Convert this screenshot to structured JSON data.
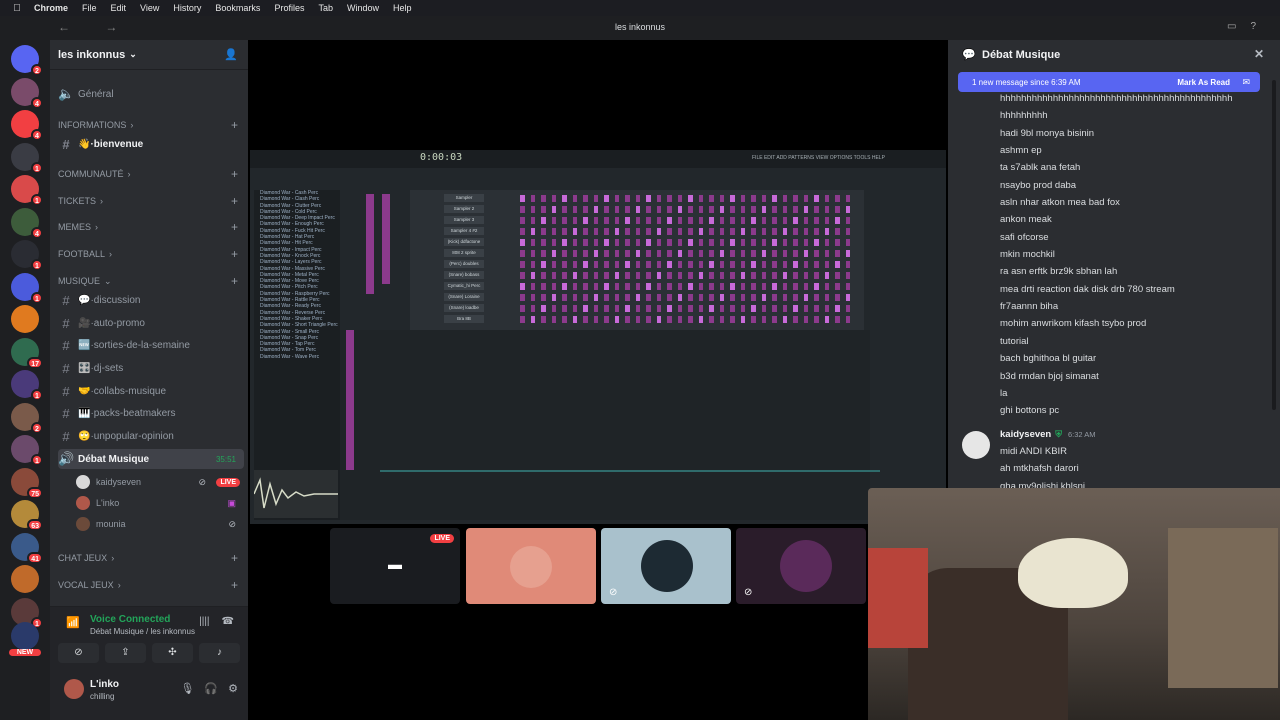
{
  "menubar": {
    "app": "Chrome",
    "items": [
      "File",
      "Edit",
      "View",
      "History",
      "Bookmarks",
      "Profiles",
      "Tab",
      "Window",
      "Help"
    ]
  },
  "window": {
    "title": "les inkonnus"
  },
  "rail": {
    "servers": [
      {
        "badge": "2",
        "color": "#5865f2"
      },
      {
        "badge": "4",
        "color": "#7a4b6a"
      },
      {
        "badge": "4",
        "color": "#f23f42"
      },
      {
        "badge": "1",
        "color": "#3a3c44"
      },
      {
        "badge": "1",
        "color": "#d94a4a"
      },
      {
        "badge": "4",
        "color": "#3d5c3b"
      },
      {
        "badge": "1",
        "color": "#2a2c33"
      },
      {
        "badge": "1",
        "color": "#4b5bdc"
      },
      {
        "badge": "",
        "color": "#e07a1f"
      },
      {
        "badge": "17",
        "color": "#2f6b4f"
      },
      {
        "badge": "1",
        "color": "#4a3a7a"
      },
      {
        "badge": "2",
        "color": "#7a5a4a"
      },
      {
        "badge": "1",
        "color": "#6b4a6b"
      },
      {
        "badge": "75",
        "color": "#8a4a3a"
      },
      {
        "badge": "63",
        "color": "#b48a3a"
      },
      {
        "badge": "41",
        "color": "#3a5a8a"
      },
      {
        "badge": "",
        "color": "#c06a2a"
      },
      {
        "badge": "1",
        "color": "#5a3a3a"
      }
    ],
    "new_label": "NEW"
  },
  "server": {
    "name": "les inkonnus"
  },
  "channels": {
    "general": "Général",
    "cat_informations": "INFORMATIONS",
    "bienvenue": "👋·bienvenue",
    "cat_communaute": "COMMUNAUTÉ",
    "cat_tickets": "TICKETS",
    "cat_memes": "MEMES",
    "cat_football": "FOOTBALL",
    "cat_musique": "MUSIQUE",
    "discussion": "💬·discussion",
    "auto_promo": "🎥·auto-promo",
    "sorties": "🆕·sorties-de-la-semaine",
    "dj_sets": "🎛️·dj-sets",
    "collabs": "🤝·collabs-musique",
    "packs": "🎹·packs-beatmakers",
    "unpopular": "🙄·unpopular-opinion",
    "debat": "Débat Musique",
    "debat_time": "35:51",
    "voice_users": [
      {
        "name": "kaidyseven",
        "live": "LIVE",
        "color": "#d9d9d9"
      },
      {
        "name": "L'inko",
        "color": "#b0584a"
      },
      {
        "name": "mounia",
        "color": "#6b4a3a"
      }
    ],
    "cat_chat_jeux": "CHAT JEUX",
    "cat_vocal_jeux": "VOCAL JEUX"
  },
  "voice": {
    "status": "Voice Connected",
    "location": "Débat Musique / les inkonnus"
  },
  "user": {
    "name": "L'inko",
    "status": "chilling"
  },
  "daw": {
    "time": "0:00:03",
    "menu": "FILE EDIT ADD PATTERNS VIEW OPTIONS TOOLS HELP",
    "browser_items": [
      "Diamond War - Cash Perc",
      "Diamond War - Clash Perc",
      "Diamond War - Clutter Perc",
      "Diamond War - Cold Perc",
      "Diamond War - Deep Impact Perc",
      "Diamond War - Enough Perc",
      "Diamond War - Fuck Hit Perc",
      "Diamond War - Hat Perc",
      "Diamond War - Hit Perc",
      "Diamond War - Impact Perc",
      "Diamond War - Knock Perc",
      "Diamond War - Layers Perc",
      "Diamond War - Massive Perc",
      "Diamond War - Metal Perc",
      "Diamond War - Move Perc",
      "Diamond War - Pitch Perc",
      "Diamond War - Raspberry Perc",
      "Diamond War - Rattle Perc",
      "Diamond War - Ready Perc",
      "Diamond War - Reverse Perc",
      "Diamond War - Shaker Perc",
      "Diamond War - Short Triangle Perc",
      "Diamond War - Small Perc",
      "Diamond War - Snap Perc",
      "Diamond War - Tap Perc",
      "Diamond War - Tom Perc",
      "Diamond War - Wave Perc"
    ],
    "rack_rows": [
      "Sampler",
      "Sampler 2",
      "Sampler 3",
      "Sampler 4 #2",
      "(Kick) ddfactone",
      "808 2 sprite",
      "(Perc) doubles",
      "(Snare) bobass",
      "Cymatic_hi Perc",
      "(Snare) Loraine",
      "(Snare) loadbe",
      "Bra 8B"
    ]
  },
  "stream_tiles": [
    {
      "name": "screen-share",
      "live": "LIVE",
      "bg": "#1a1c20"
    },
    {
      "name": "cat",
      "bg": "#e08a78"
    },
    {
      "name": "user-av",
      "bg": "#a9c1cc"
    },
    {
      "name": "art",
      "bg": "#2a1c2a"
    }
  ],
  "chat": {
    "title": "Débat Musique",
    "new_message": "1 new message since 6:39 AM",
    "mark_read": "Mark As Read",
    "messages": [
      "hhhhhhhhhhhhhhhhhhhhhhhhhhhhhhhhhhhhhhhhhhhh",
      "hhhhhhhhh",
      "hadi 9bl monya bisinin",
      "ashmn ep",
      "ta s7ablk ana fetah",
      "nsaybo prod daba",
      "asln nhar atkon mea bad fox",
      "ankon meak",
      "safi ofcorse",
      "mkin mochkil",
      "ra asn erftk brz9k sbhan lah",
      "mea drti reaction dak disk drb 780 stream",
      "fr7aannn biha",
      "mohim anwrikom kifash tsybo prod",
      "tutorial",
      "bach bghithoa bl guitar",
      "b3d rmdan bjoj simanat",
      "la",
      "ghi bottons pc"
    ],
    "author": "kaidyseven",
    "author_time": "6:32 AM",
    "messages2": [
      "midi ANDI KBIR",
      "ah mtkhafsh darori",
      "gha my9olishi khlsni"
    ]
  }
}
